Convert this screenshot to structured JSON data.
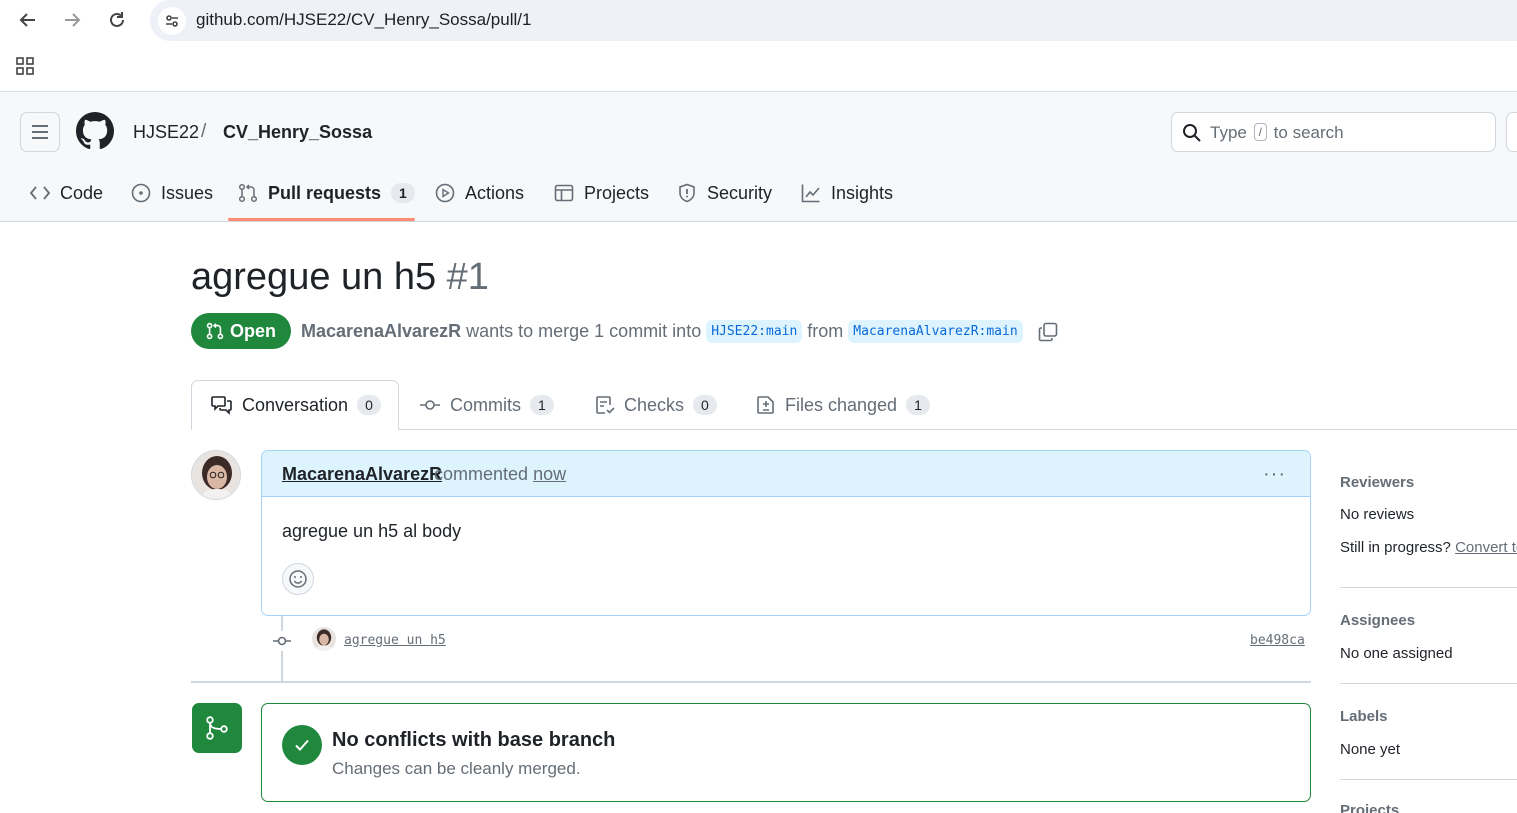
{
  "browser": {
    "url": "github.com/HJSE22/CV_Henry_Sossa/pull/1"
  },
  "header": {
    "owner": "HJSE22",
    "separator": "/",
    "repo": "CV_Henry_Sossa",
    "search": {
      "prefix": "Type",
      "key": "/",
      "suffix": "to search"
    }
  },
  "repo_tabs": [
    {
      "label": "Code",
      "icon": "code-icon"
    },
    {
      "label": "Issues",
      "icon": "issue-icon"
    },
    {
      "label": "Pull requests",
      "icon": "pull-request-icon",
      "count": "1",
      "selected": true
    },
    {
      "label": "Actions",
      "icon": "play-icon"
    },
    {
      "label": "Projects",
      "icon": "table-icon"
    },
    {
      "label": "Security",
      "icon": "shield-icon"
    },
    {
      "label": "Insights",
      "icon": "graph-icon"
    }
  ],
  "pr": {
    "title": "agregue un h5",
    "number": "#1",
    "state": "Open",
    "author": "MacarenaAlvarezR",
    "merge_text_1": "wants to merge 1 commit into",
    "base_branch": "HJSE22:main",
    "merge_text_2": "from",
    "head_branch": "MacarenaAlvarezR:main"
  },
  "pr_tabs": [
    {
      "label": "Conversation",
      "count": "0",
      "icon": "comment-discussion-icon",
      "selected": true
    },
    {
      "label": "Commits",
      "count": "1",
      "icon": "commit-icon"
    },
    {
      "label": "Checks",
      "count": "0",
      "icon": "checklist-icon"
    },
    {
      "label": "Files changed",
      "count": "1",
      "icon": "diff-icon"
    }
  ],
  "comment": {
    "author": "MacarenaAlvarezR",
    "verb": "commented",
    "time": "now",
    "body": "agregue un h5 al body",
    "more": "···"
  },
  "commit": {
    "message": "agregue un h5",
    "sha": "be498ca"
  },
  "merge_status": {
    "title": "No conflicts with base branch",
    "subtitle": "Changes can be cleanly merged."
  },
  "sidebar": {
    "reviewers_heading": "Reviewers",
    "reviewers_value": "No reviews",
    "in_progress_text": "Still in progress?",
    "convert_link": "Convert to draft",
    "assignees_heading": "Assignees",
    "assignees_value": "No one assigned",
    "labels_heading": "Labels",
    "labels_value": "None yet",
    "projects_heading": "Projects"
  },
  "colors": {
    "open_green": "#1f883d",
    "accent_underline": "#fd8c73",
    "link_blue": "#0969da",
    "comment_header_bg": "#ddf4ff"
  }
}
